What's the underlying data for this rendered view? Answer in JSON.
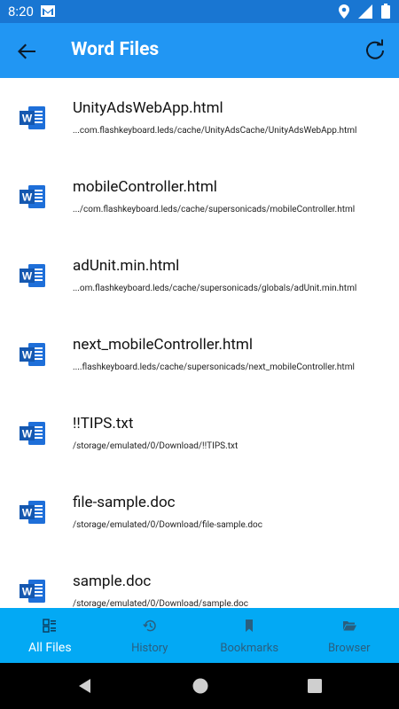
{
  "status": {
    "time": "8:20"
  },
  "appbar": {
    "title": "Word Files"
  },
  "files": [
    {
      "name": "UnityAdsWebApp.html",
      "path": "...com.flashkeyboard.leds/cache/UnityAdsCache/UnityAdsWebApp.html"
    },
    {
      "name": "mobileController.html",
      "path": ".../com.flashkeyboard.leds/cache/supersonicads/mobileController.html"
    },
    {
      "name": "adUnit.min.html",
      "path": "...om.flashkeyboard.leds/cache/supersonicads/globals/adUnit.min.html"
    },
    {
      "name": "next_mobileController.html",
      "path": "....flashkeyboard.leds/cache/supersonicads/next_mobileController.html"
    },
    {
      "name": "!!TIPS.txt",
      "path": "/storage/emulated/0/Download/!!TIPS.txt"
    },
    {
      "name": "file-sample.doc",
      "path": "/storage/emulated/0/Download/file-sample.doc"
    },
    {
      "name": "sample.doc",
      "path": "/storage/emulated/0/Download/sample.doc"
    }
  ],
  "bottom_nav": [
    {
      "label": "All Files",
      "icon": "all-files-icon",
      "active": true
    },
    {
      "label": "History",
      "icon": "history-icon",
      "active": false
    },
    {
      "label": "Bookmarks",
      "icon": "bookmark-icon",
      "active": false
    },
    {
      "label": "Browser",
      "icon": "folder-open-icon",
      "active": false
    }
  ],
  "colors": {
    "statusbar": "#1976d2",
    "appbar": "#2196f3",
    "bottom_nav": "#03a9f4",
    "word_blue": "#1e6fd9"
  }
}
